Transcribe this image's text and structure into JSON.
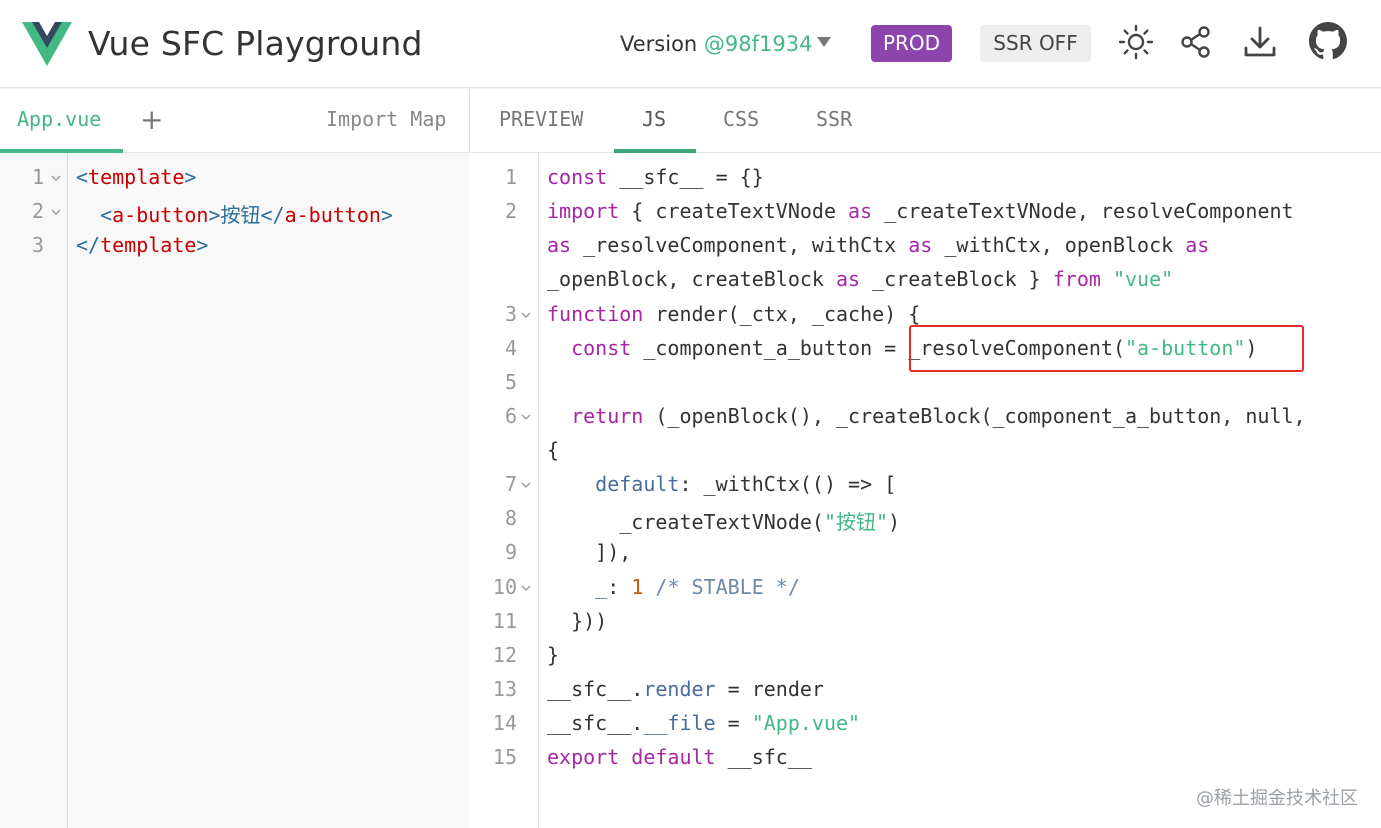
{
  "header": {
    "title": "Vue SFC Playground",
    "version_label": "Version",
    "version_hash": "@98f1934",
    "prod_label": "PROD",
    "ssr_label": "SSR OFF",
    "icons": [
      "sun-icon",
      "share-icon",
      "download-icon",
      "github-icon"
    ]
  },
  "left_pane": {
    "active_tab": "App.vue",
    "add_tab": "+",
    "import_map": "Import Map",
    "lines": [
      {
        "n": "1",
        "fold": true,
        "text": [
          "<",
          "template",
          ">"
        ]
      },
      {
        "n": "2",
        "fold": true,
        "text": [
          "  <",
          "a-button",
          ">按钮</",
          "a-button",
          ">"
        ]
      },
      {
        "n": "3",
        "fold": false,
        "text": [
          "</",
          "template",
          ">"
        ]
      }
    ]
  },
  "right_pane": {
    "tabs": [
      "PREVIEW",
      "JS",
      "CSS",
      "SSR"
    ],
    "active_tab": "JS",
    "line_numbers": [
      "1",
      "2",
      "3",
      "4",
      "5",
      "6",
      "7",
      "8",
      "9",
      "10",
      "11",
      "12",
      "13",
      "14",
      "15"
    ],
    "code": {
      "l1": {
        "kw": "const",
        "rest": " __sfc__ = {}"
      },
      "l2a": {
        "kw": "import",
        "rest1": " { createTextVNode ",
        "as": "as",
        "rest2": " _createTextVNode, resolveComponent"
      },
      "l2b": {
        "as1": "as",
        "rest1": " _resolveComponent, withCtx ",
        "as2": "as",
        "rest2": " _withCtx, openBlock ",
        "as3": "as"
      },
      "l2c": {
        "rest1": "_openBlock, createBlock ",
        "as": "as",
        "rest2": " _createBlock } ",
        "from": "from",
        "str": "\"vue\""
      },
      "l3": {
        "kw": "function",
        "rest": " render(_ctx, _cache) {"
      },
      "l4": {
        "kw": "  const",
        "rest1": " _component_a_button = _resolveComponent(",
        "str": "\"a-button\"",
        "rest2": ")"
      },
      "l6a": {
        "kw": "  return",
        "rest": " (_openBlock(), _createBlock(_component_a_button, null,"
      },
      "l6b": {
        "rest": "{"
      },
      "l7": {
        "prop": "    default",
        "rest": ": _withCtx(() => ["
      },
      "l8": {
        "rest1": "      _createTextVNode(",
        "str": "\"按钮\"",
        "rest2": ")"
      },
      "l9": {
        "rest": "    ]),"
      },
      "l10": {
        "prop": "    _",
        "rest1": ": ",
        "num": "1",
        "cmt": " /* STABLE */"
      },
      "l11": {
        "rest": "  }))"
      },
      "l12": {
        "rest": "}"
      },
      "l13": {
        "rest1": "__sfc__.",
        "prop": "render",
        "rest2": " = render"
      },
      "l14": {
        "rest1": "__sfc__.",
        "prop": "__file",
        "rest2": " = ",
        "str": "\"App.vue\""
      },
      "l15": {
        "kw1": "export",
        "kw2": " default",
        "rest": " __sfc__"
      }
    }
  },
  "watermark": "@稀土掘金技术社区",
  "colors": {
    "accent": "#42b883",
    "prod": "#8e44ad",
    "keyword": "#a626a4",
    "highlight_border": "#e52b2b"
  }
}
